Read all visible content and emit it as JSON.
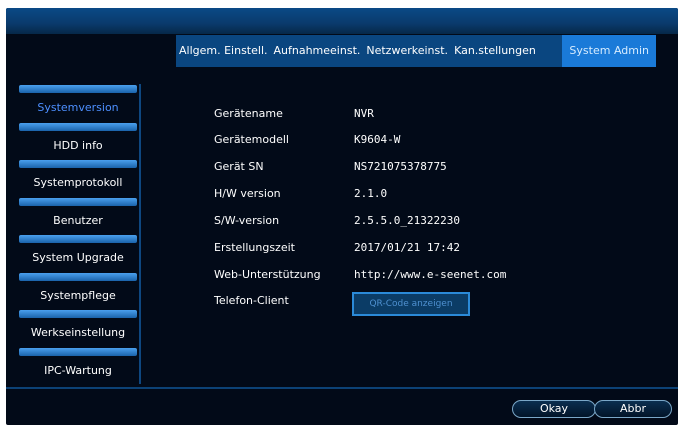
{
  "tabs": [
    {
      "label": "Allgem. Einstell."
    },
    {
      "label": "Aufnahmeeinst."
    },
    {
      "label": "Netzwerkeinst."
    },
    {
      "label": "Kan.stellungen"
    },
    {
      "label": "System Admin"
    }
  ],
  "sidebar": {
    "items": [
      {
        "label": "Systemversion"
      },
      {
        "label": "HDD info"
      },
      {
        "label": "Systemprotokoll"
      },
      {
        "label": "Benutzer"
      },
      {
        "label": "System Upgrade"
      },
      {
        "label": "Systempflege"
      },
      {
        "label": "Werkseinstellung"
      },
      {
        "label": "IPC-Wartung"
      }
    ]
  },
  "info": {
    "rows": [
      {
        "label": "Gerätename",
        "value": "NVR"
      },
      {
        "label": "Gerätemodell",
        "value": "K9604-W"
      },
      {
        "label": "Gerät SN",
        "value": "NS721075378775"
      },
      {
        "label": "H/W version",
        "value": "2.1.0"
      },
      {
        "label": "S/W-version",
        "value": "2.5.5.0_21322230"
      },
      {
        "label": "Erstellungszeit",
        "value": "2017/01/21 17:42"
      },
      {
        "label": "Web-Unterstützung",
        "value": "http://www.e-seenet.com"
      },
      {
        "label": "Telefon-Client",
        "value": ""
      }
    ],
    "qr_button": "QR-Code anzeigen"
  },
  "buttons": {
    "ok": "Okay",
    "cancel": "Abbr"
  },
  "colors": {
    "background": "#020a18",
    "tab_bar": "#0a4680",
    "tab_active": "#1a7ad8",
    "sidebar_active_text": "#4d8fff"
  }
}
